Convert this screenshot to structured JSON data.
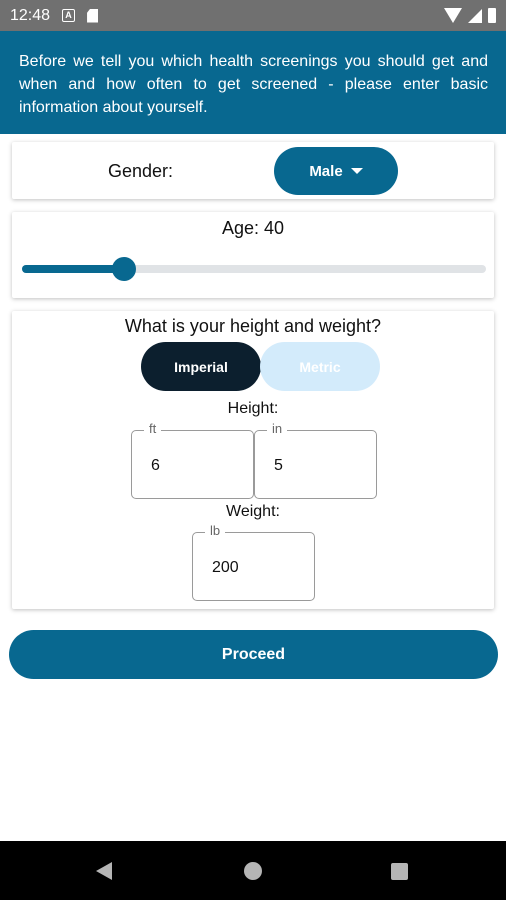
{
  "status_bar": {
    "time": "12:48",
    "icons": [
      "a-notification-icon",
      "sd-card-icon",
      "wifi-icon",
      "signal-icon",
      "battery-icon"
    ]
  },
  "banner": {
    "text": "Before we tell you which health screenings you should get and when and how often to get screened - please enter basic information about yourself."
  },
  "gender": {
    "label": "Gender:",
    "selected": "Male"
  },
  "age": {
    "label": "Age: 40",
    "slider_fraction": 0.22
  },
  "height_weight": {
    "title": "What is your height and weight?",
    "unit_imperial": "Imperial",
    "unit_metric": "Metric",
    "height_label": "Height:",
    "ft_legend": "ft",
    "ft_value": "6",
    "in_legend": "in",
    "in_value": "5",
    "weight_label": "Weight:",
    "lb_legend": "lb",
    "lb_value": "200"
  },
  "proceed_label": "Proceed",
  "colors": {
    "primary": "#086890",
    "imperial_active": "#0c1f2e",
    "metric_inactive": "#d3ebfb"
  }
}
